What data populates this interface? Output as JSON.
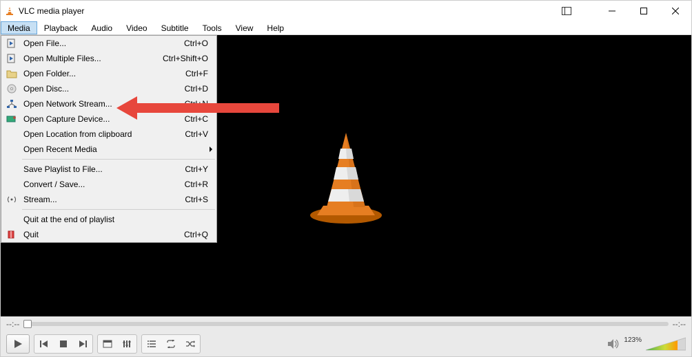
{
  "title": "VLC media player",
  "menubar": [
    "Media",
    "Playback",
    "Audio",
    "Video",
    "Subtitle",
    "Tools",
    "View",
    "Help"
  ],
  "active_menu_index": 0,
  "media_menu": [
    {
      "type": "item",
      "icon": "file",
      "label": "Open File...",
      "shortcut": "Ctrl+O"
    },
    {
      "type": "item",
      "icon": "file",
      "label": "Open Multiple Files...",
      "shortcut": "Ctrl+Shift+O"
    },
    {
      "type": "item",
      "icon": "folder",
      "label": "Open Folder...",
      "shortcut": "Ctrl+F"
    },
    {
      "type": "item",
      "icon": "disc",
      "label": "Open Disc...",
      "shortcut": "Ctrl+D"
    },
    {
      "type": "item",
      "icon": "network",
      "label": "Open Network Stream...",
      "shortcut": "Ctrl+N"
    },
    {
      "type": "item",
      "icon": "capture",
      "label": "Open Capture Device...",
      "shortcut": "Ctrl+C"
    },
    {
      "type": "item",
      "icon": "",
      "label": "Open Location from clipboard",
      "shortcut": "Ctrl+V"
    },
    {
      "type": "submenu",
      "icon": "",
      "label": "Open Recent Media",
      "shortcut": ""
    },
    {
      "type": "sep"
    },
    {
      "type": "item",
      "icon": "",
      "label": "Save Playlist to File...",
      "shortcut": "Ctrl+Y"
    },
    {
      "type": "item",
      "icon": "",
      "label": "Convert / Save...",
      "shortcut": "Ctrl+R"
    },
    {
      "type": "item",
      "icon": "stream",
      "label": "Stream...",
      "shortcut": "Ctrl+S"
    },
    {
      "type": "sep"
    },
    {
      "type": "item",
      "icon": "",
      "label": "Quit at the end of playlist",
      "shortcut": ""
    },
    {
      "type": "item",
      "icon": "quit",
      "label": "Quit",
      "shortcut": "Ctrl+Q"
    }
  ],
  "seek": {
    "left": "--:--",
    "right": "--:--"
  },
  "volume": {
    "label": "123%",
    "level": 1.23
  },
  "annotation": {
    "arrow_target": "Open Network Stream..."
  }
}
